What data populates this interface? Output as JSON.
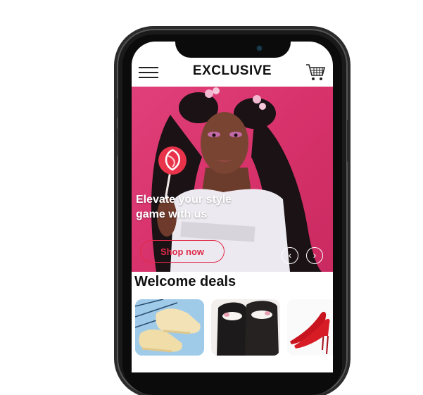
{
  "app": {
    "title": "EXCLUSIVE"
  },
  "hero": {
    "headline_line1": "Elevate your style",
    "headline_line2": "game with us",
    "cta_label": "Shop now",
    "prev_arrow": "‹",
    "next_arrow": "›"
  },
  "deals": {
    "title": "Welcome deals",
    "items": [
      {
        "icon": "sneakers-image"
      },
      {
        "icon": "slippers-image"
      },
      {
        "icon": "red-heels-image"
      }
    ]
  },
  "icons": {
    "menu": "hamburger-menu-icon",
    "cart": "shopping-cart-icon"
  },
  "colors": {
    "hero_background": "#d8326b",
    "cta_border": "#e02a4a",
    "title_text": "#111111"
  }
}
